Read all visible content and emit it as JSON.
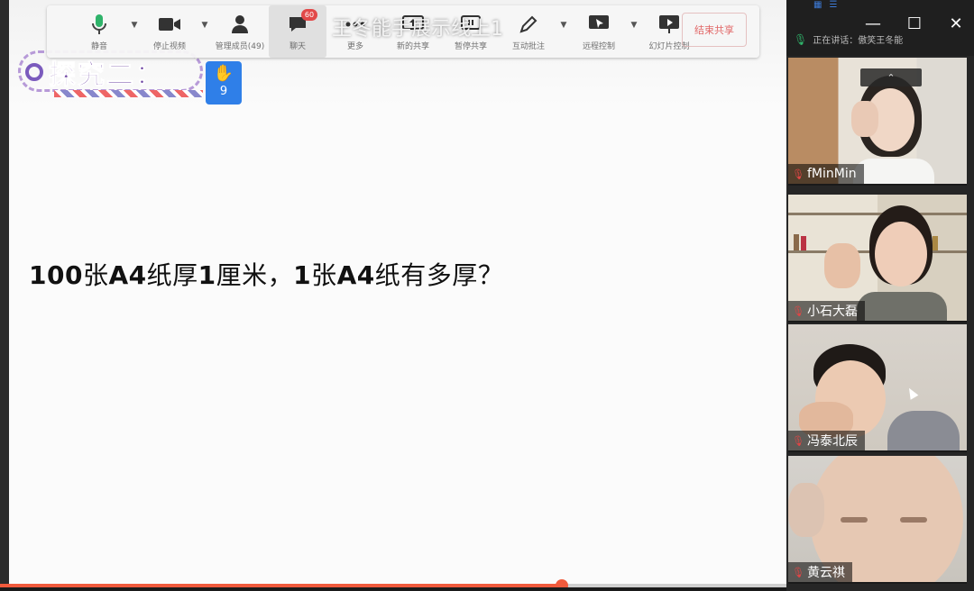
{
  "window": {
    "title": "王冬能手展示线上1",
    "controls": {
      "minimize": "—",
      "maximize": "☐",
      "close": "✕"
    }
  },
  "toolbar": {
    "items": [
      {
        "id": "mute",
        "label": "静音",
        "icon": "microphone-icon",
        "has_caret": true,
        "active": false
      },
      {
        "id": "video",
        "label": "停止视频",
        "icon": "video-camera-icon",
        "has_caret": true,
        "active": false
      },
      {
        "id": "participants",
        "label": "管理成员(49)",
        "icon": "person-icon",
        "has_caret": false,
        "active": false
      },
      {
        "id": "chat",
        "label": "聊天",
        "icon": "chat-bubble-icon",
        "has_caret": false,
        "active": true,
        "badge": "60"
      },
      {
        "id": "more",
        "label": "更多",
        "icon": "more-dots-icon",
        "has_caret": false,
        "active": false
      },
      {
        "id": "new_share",
        "label": "新的共享",
        "icon": "share-screen-icon",
        "has_caret": false,
        "active": false
      },
      {
        "id": "pause_share",
        "label": "暂停共享",
        "icon": "pause-icon",
        "has_caret": false,
        "active": false
      },
      {
        "id": "annotate",
        "label": "互动批注",
        "icon": "pen-icon",
        "has_caret": true,
        "active": false
      },
      {
        "id": "remote_control",
        "label": "远程控制",
        "icon": "remote-control-icon",
        "has_caret": true,
        "active": false
      },
      {
        "id": "slideshow",
        "label": "幻灯片控制",
        "icon": "slideshow-icon",
        "has_caret": false,
        "active": false
      }
    ],
    "end_share_label": "结束共享"
  },
  "slide": {
    "section_title": "探究二：",
    "raised_hand_count": "9",
    "question_parts": [
      {
        "text": "100",
        "bold": true
      },
      {
        "text": "张",
        "bold": false
      },
      {
        "text": "A4",
        "bold": true
      },
      {
        "text": "纸厚",
        "bold": false
      },
      {
        "text": "1",
        "bold": true
      },
      {
        "text": "厘米，",
        "bold": false
      },
      {
        "text": "1",
        "bold": true
      },
      {
        "text": "张",
        "bold": false
      },
      {
        "text": "A4",
        "bold": true
      },
      {
        "text": "纸有多厚？",
        "bold": false
      }
    ]
  },
  "playback": {
    "progress": 0.715,
    "fill_color": "#f05a3c"
  },
  "side_panel": {
    "speaking_label": "正在讲话：傲笑王冬能",
    "collapse_glyph": "⌃",
    "participants": [
      {
        "name": "fMinMin",
        "muted": true
      },
      {
        "name": "小石大磊",
        "muted": true
      },
      {
        "name": "冯泰北辰",
        "muted": true
      },
      {
        "name": "黄云祺",
        "muted": true
      }
    ]
  },
  "colors": {
    "accent_blue": "#2f7fe8",
    "badge_red": "#e24848",
    "mic_green": "#2fb36a"
  }
}
